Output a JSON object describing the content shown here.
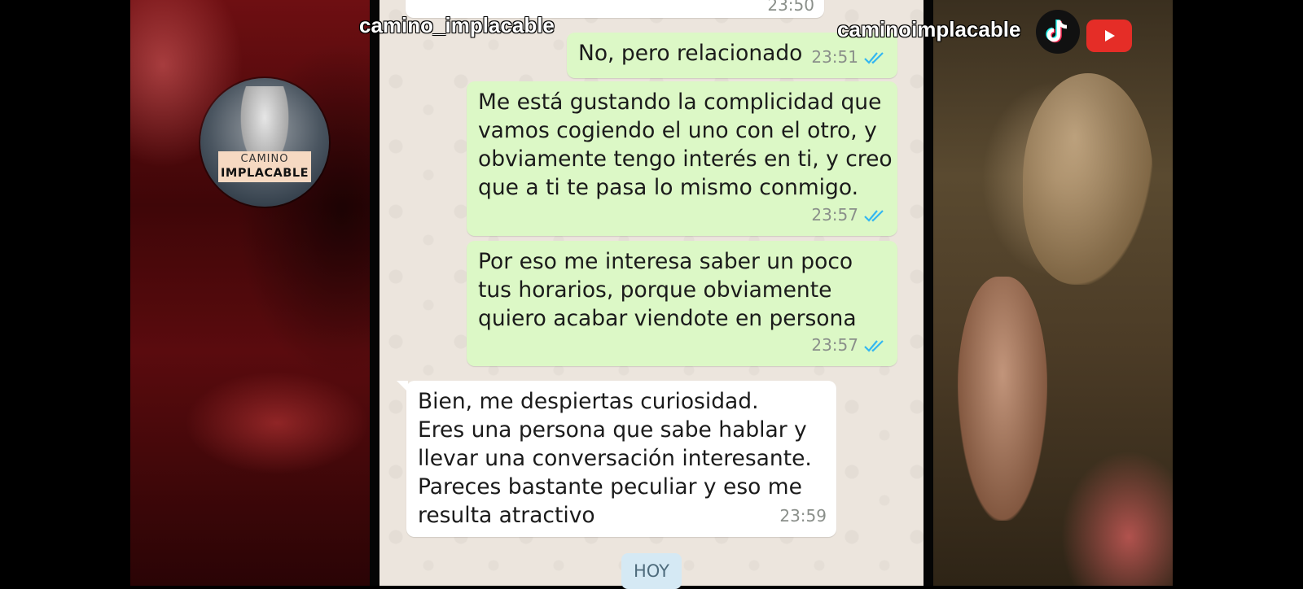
{
  "watermarks": {
    "left_handle": "camino_implacable",
    "right_handle": "caminoimplacable"
  },
  "logo": {
    "line1": "CAMINO",
    "line2": "IMPLACABLE"
  },
  "social_icons": [
    "tiktok-icon",
    "youtube-icon"
  ],
  "chat": {
    "top_fragment_time": "23:50",
    "messages": [
      {
        "direction": "outgoing",
        "text": "No, pero relacionado",
        "time": "23:51",
        "status": "read"
      },
      {
        "direction": "outgoing",
        "text": "Me está gustando la complicidad que\nvamos cogiendo el uno con el otro, y\nobviamente tengo interés en ti, y creo\nque a ti te pasa lo mismo conmigo.",
        "time": "23:57",
        "status": "read"
      },
      {
        "direction": "outgoing",
        "text": "Por eso me interesa saber un poco\ntus horarios, porque obviamente\nquiero acabar viendote en persona",
        "time": "23:57",
        "status": "read"
      },
      {
        "direction": "incoming",
        "text": "Bien, me despiertas curiosidad.\nEres una persona que sabe hablar y\nllevar una conversación interesante.\nPareces bastante peculiar y eso me\nresulta atractivo",
        "time": "23:59"
      }
    ],
    "date_chip": "HOY"
  },
  "colors": {
    "outgoing_bubble": "#dcf8c6",
    "incoming_bubble": "#ffffff",
    "chat_background": "#ece5dd",
    "read_ticks": "#34b7f1",
    "youtube_red": "#e52d27"
  }
}
